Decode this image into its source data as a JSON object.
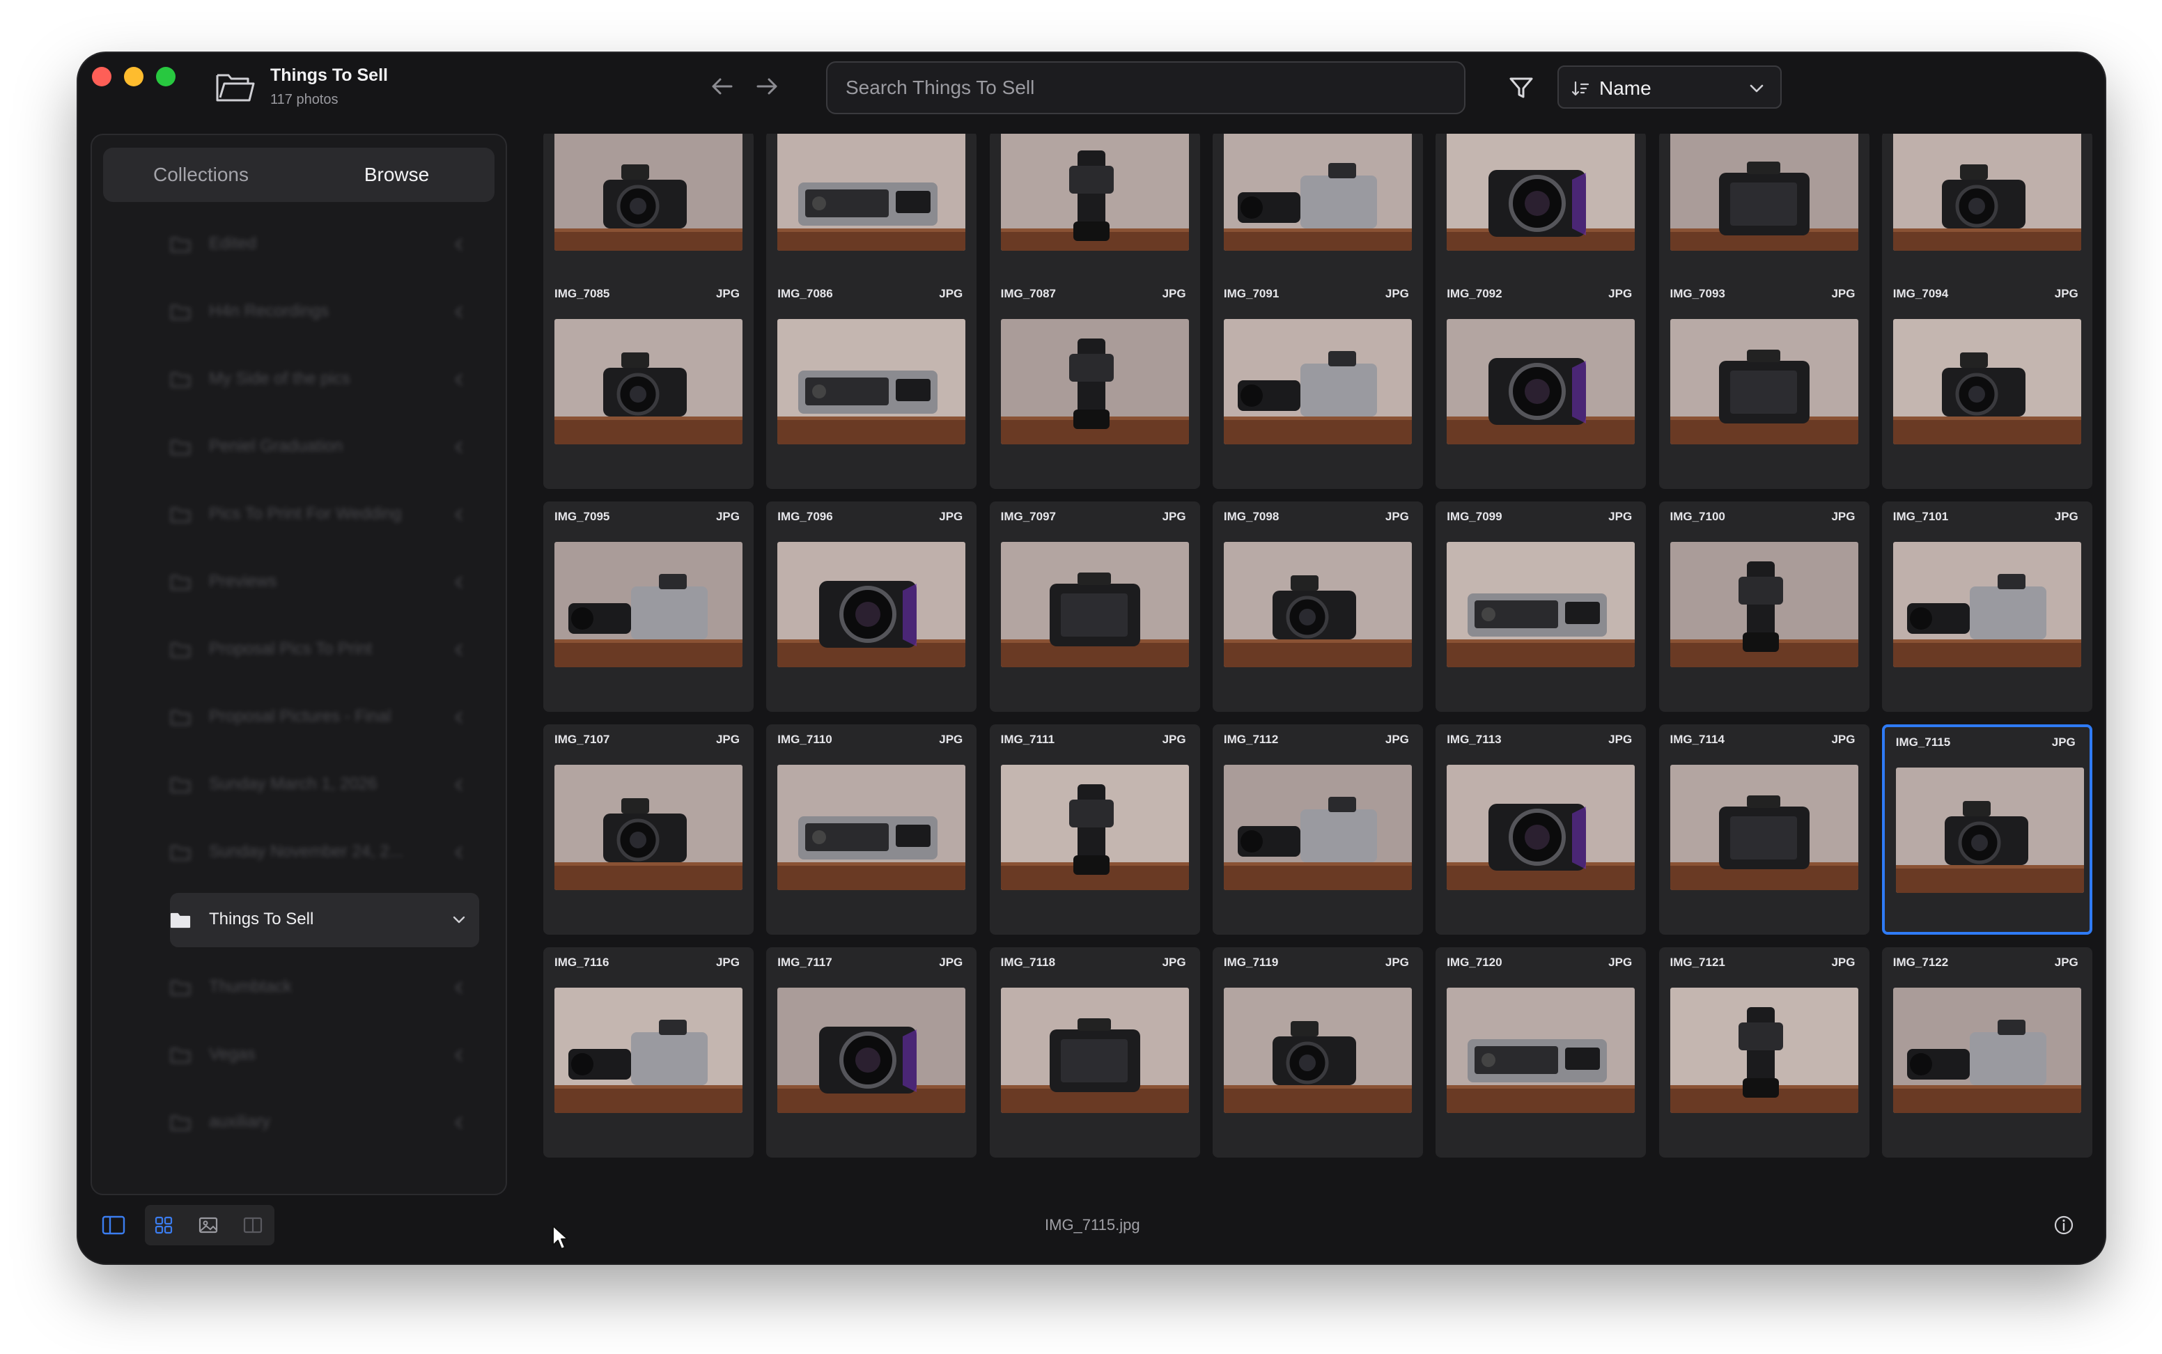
{
  "window": {
    "title": "Things To Sell",
    "subtitle": "117 photos"
  },
  "search": {
    "placeholder": "Search Things To Sell",
    "value": ""
  },
  "sort": {
    "label": "Name"
  },
  "sidebar": {
    "tabs": [
      {
        "label": "Collections",
        "active": false
      },
      {
        "label": "Browse",
        "active": true
      }
    ],
    "items": [
      {
        "label": "Edited",
        "active": false
      },
      {
        "label": "H4n Recordings",
        "active": false
      },
      {
        "label": "My Side of the pics",
        "active": false
      },
      {
        "label": "Peniel Graduation",
        "active": false
      },
      {
        "label": "Pics To Print For Wedding",
        "active": false
      },
      {
        "label": "Previews",
        "active": false
      },
      {
        "label": "Proposal Pics To Print",
        "active": false
      },
      {
        "label": "Proposal Pictures - Final",
        "active": false
      },
      {
        "label": "Sunday March 1, 2026",
        "active": false
      },
      {
        "label": "Sunday November 24, 2...",
        "active": false
      },
      {
        "label": "Things To Sell",
        "active": true
      },
      {
        "label": "Thumbtack",
        "active": false
      },
      {
        "label": "Vegas",
        "active": false
      },
      {
        "label": "auxiliary",
        "active": false
      }
    ]
  },
  "photos": {
    "top_row": [
      {
        "name": "",
        "type": ""
      },
      {
        "name": "",
        "type": ""
      },
      {
        "name": "",
        "type": ""
      },
      {
        "name": "",
        "type": ""
      },
      {
        "name": "",
        "type": ""
      },
      {
        "name": "",
        "type": ""
      },
      {
        "name": "",
        "type": ""
      }
    ],
    "rows": [
      [
        {
          "name": "IMG_7085",
          "type": "JPG"
        },
        {
          "name": "IMG_7086",
          "type": "JPG"
        },
        {
          "name": "IMG_7087",
          "type": "JPG"
        },
        {
          "name": "IMG_7091",
          "type": "JPG"
        },
        {
          "name": "IMG_7092",
          "type": "JPG"
        },
        {
          "name": "IMG_7093",
          "type": "JPG"
        },
        {
          "name": "IMG_7094",
          "type": "JPG"
        }
      ],
      [
        {
          "name": "IMG_7095",
          "type": "JPG"
        },
        {
          "name": "IMG_7096",
          "type": "JPG"
        },
        {
          "name": "IMG_7097",
          "type": "JPG"
        },
        {
          "name": "IMG_7098",
          "type": "JPG"
        },
        {
          "name": "IMG_7099",
          "type": "JPG"
        },
        {
          "name": "IMG_7100",
          "type": "JPG"
        },
        {
          "name": "IMG_7101",
          "type": "JPG"
        }
      ],
      [
        {
          "name": "IMG_7107",
          "type": "JPG"
        },
        {
          "name": "IMG_7110",
          "type": "JPG"
        },
        {
          "name": "IMG_7111",
          "type": "JPG"
        },
        {
          "name": "IMG_7112",
          "type": "JPG"
        },
        {
          "name": "IMG_7113",
          "type": "JPG"
        },
        {
          "name": "IMG_7114",
          "type": "JPG"
        },
        {
          "name": "IMG_7115",
          "type": "JPG",
          "selected": true
        }
      ],
      [
        {
          "name": "IMG_7116",
          "type": "JPG"
        },
        {
          "name": "IMG_7117",
          "type": "JPG"
        },
        {
          "name": "IMG_7118",
          "type": "JPG"
        },
        {
          "name": "IMG_7119",
          "type": "JPG"
        },
        {
          "name": "IMG_7120",
          "type": "JPG"
        },
        {
          "name": "IMG_7121",
          "type": "JPG"
        },
        {
          "name": "IMG_7122",
          "type": "JPG"
        }
      ]
    ]
  },
  "status": {
    "selected_file": "IMG_7115.jpg"
  },
  "colors": {
    "accent": "#2f7bf5",
    "window_bg": "#151517",
    "tile_bg": "#262628"
  }
}
